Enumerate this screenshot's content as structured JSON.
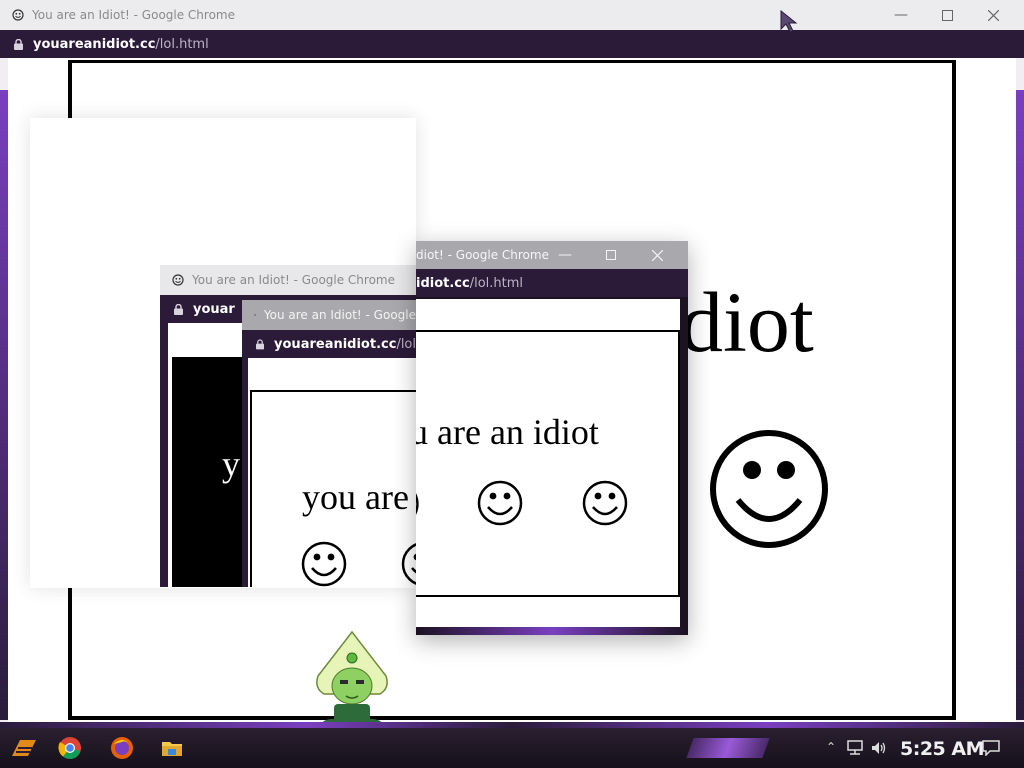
{
  "main_window": {
    "title": "You are an Idiot! - Google Chrome",
    "url_host": "youareanidiot.cc",
    "url_path": "/lol.html",
    "page_text_fragment": "diot"
  },
  "window_front": {
    "title": "diot! - Google Chrome",
    "url_host": "idiot.cc",
    "url_path": "/lol.html",
    "page_text": "u are an idiot"
  },
  "window_back_left": {
    "title": "You are an Idiot! - Google Chrome",
    "url_fragment": "youar",
    "page_text_fragment": "y"
  },
  "window_middle": {
    "title": "You are an Idiot! - Google",
    "url_host": "youareanidiot.cc",
    "url_path": "/lol",
    "page_text": "you are"
  },
  "taskbar": {
    "clock": "5:25 AM"
  },
  "colors": {
    "url_bar": "#2b1a38",
    "accent_purple": "#7a3fc0"
  }
}
